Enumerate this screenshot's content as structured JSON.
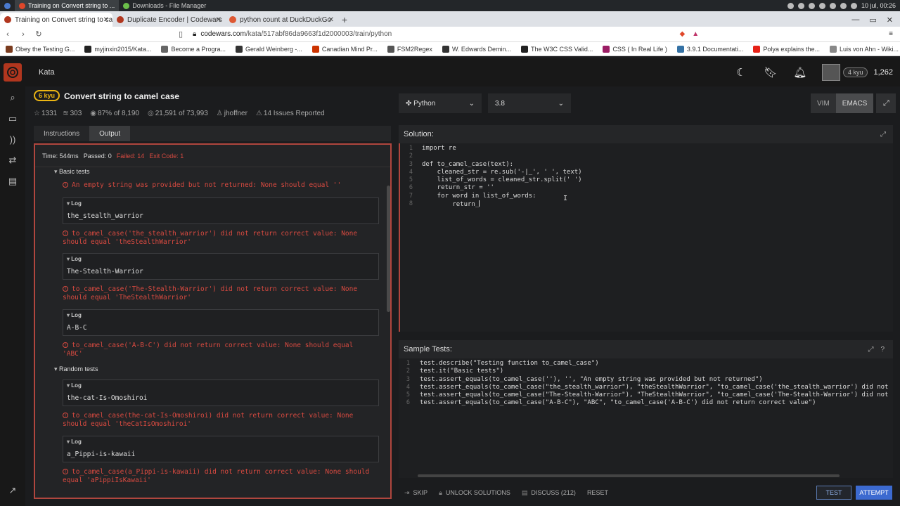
{
  "os": {
    "tabs": [
      {
        "label": "Training on Convert string to ...",
        "active": true
      },
      {
        "label": "Downloads - File Manager",
        "active": false
      }
    ],
    "clock": "10 jul, 00:26"
  },
  "browser": {
    "tabs": [
      {
        "label": "Training on Convert string to cam",
        "fav_color": "#b1361e"
      },
      {
        "label": "Duplicate Encoder | Codewars",
        "fav_color": "#b1361e"
      },
      {
        "label": "python count at DuckDuckGo",
        "fav_color": "#de5833"
      }
    ],
    "url_host": "codewars.com",
    "url_path": "/kata/517abf86da9663f1d2000003/train/python",
    "bookmarks": [
      {
        "label": "Obey the Testing G...",
        "color": "#7a3b1e"
      },
      {
        "label": "myjinxin2015/Kata...",
        "color": "#222222"
      },
      {
        "label": "Become a Progra...",
        "color": "#666666"
      },
      {
        "label": "Gerald Weinberg -...",
        "color": "#333333"
      },
      {
        "label": "Canadian Mind Pr...",
        "color": "#cc3300"
      },
      {
        "label": "FSM2Regex",
        "color": "#555555"
      },
      {
        "label": "W. Edwards Demin...",
        "color": "#333333"
      },
      {
        "label": "The W3C CSS Valid...",
        "color": "#222222"
      },
      {
        "label": "CSS ( In Real Life )",
        "color": "#9b1d64"
      },
      {
        "label": "3.9.1 Documentati...",
        "color": "#3572a5"
      },
      {
        "label": "Polya explains the...",
        "color": "#e62117"
      },
      {
        "label": "Luis von Ahn - Wiki...",
        "color": "#888888"
      }
    ]
  },
  "header": {
    "kata_link": "Kata",
    "rank": "4 kyu",
    "honor": "1,262"
  },
  "kata": {
    "kyu": "6 kyu",
    "title": "Convert string to camel case",
    "stars": "1331",
    "collections": "303",
    "satisfaction": "87% of 8,190",
    "completed": "21,591 of 73,993",
    "author": "jhoffner",
    "issues": "14 Issues Reported"
  },
  "left_tabs": {
    "instructions": "Instructions",
    "output": "Output"
  },
  "output": {
    "time": "Time: 544ms",
    "passed": "Passed: 0",
    "failed": "Failed: 14",
    "exit": "Exit Code: 1",
    "basic_group": "Basic tests",
    "random_group": "Random tests",
    "log_label": "Log",
    "items": [
      {
        "kind": "err",
        "text": "An empty string was provided but not returned: None should equal ''"
      },
      {
        "kind": "log",
        "text": "the_stealth_warrior"
      },
      {
        "kind": "err",
        "text": "to_camel_case('the_stealth_warrior') did not return correct value: None should equal 'theStealthWarrior'"
      },
      {
        "kind": "log",
        "text": "The-Stealth-Warrior"
      },
      {
        "kind": "err",
        "text": "to_camel_case('The-Stealth-Warrior') did not return correct value: None should equal 'TheStealthWarrior'"
      },
      {
        "kind": "log",
        "text": "A-B-C"
      },
      {
        "kind": "err",
        "text": "to_camel_case('A-B-C') did not return correct value: None should equal 'ABC'"
      },
      {
        "kind": "log",
        "text": "the-cat-Is-Omoshiroi"
      },
      {
        "kind": "err",
        "text": "to_camel_case(the-cat-Is-Omoshiroi) did not return correct value: None should equal 'theCatIsOmoshiroi'"
      },
      {
        "kind": "log",
        "text": "a_Pippi-is-kawaii"
      },
      {
        "kind": "err",
        "text": "to_camel_case(a_Pippi-is-kawaii) did not return correct value: None should equal 'aPippiIsKawaii'"
      }
    ]
  },
  "editor": {
    "language": "Python",
    "version": "3.8",
    "vim": "VIM",
    "emacs": "EMACS",
    "solution_title": "Solution:",
    "solution_lines": [
      "import re",
      "",
      "def to_camel_case(text):",
      "    cleaned_str = re.sub('-|_', ' ', text)",
      "    list_of_words = cleaned_str.split(' ')",
      "    return_str = ''",
      "    for word in list_of_words:",
      "        return_"
    ],
    "sample_title": "Sample Tests:",
    "sample_lines": [
      "test.describe(\"Testing function to_camel_case\")",
      "test.it(\"Basic tests\")",
      "test.assert_equals(to_camel_case(''), '', \"An empty string was provided but not returned\")",
      "test.assert_equals(to_camel_case(\"the_stealth_warrior\"), \"theStealthWarrior\", \"to_camel_case('the_stealth_warrior') did not return",
      "test.assert_equals(to_camel_case(\"The-Stealth-Warrior\"), \"TheStealthWarrior\", \"to_camel_case('The-Stealth-Warrior') did not return",
      "test.assert_equals(to_camel_case(\"A-B-C\"), \"ABC\", \"to_camel_case('A-B-C') did not return correct value\")"
    ]
  },
  "bottom": {
    "skip": "SKIP",
    "unlock": "UNLOCK SOLUTIONS",
    "discuss": "DISCUSS (212)",
    "reset": "RESET",
    "test": "TEST",
    "attempt": "ATTEMPT"
  }
}
